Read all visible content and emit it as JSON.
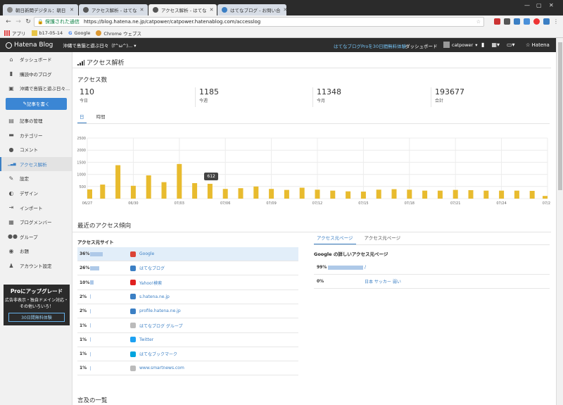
{
  "browser": {
    "tabs": [
      {
        "title": "朝日新聞デジタル：朝日",
        "color": "#888888"
      },
      {
        "title": "アクセス解析 - はてな",
        "color": "#555555"
      },
      {
        "title": "アクセス解析 - はてな",
        "color": "#555555"
      },
      {
        "title": "はてなブログ - お問い合",
        "color": "#3b7fc4"
      }
    ],
    "secure_label": "保護された通信",
    "url": "https://blog.hatena.ne.jp/catpower/catpower.hatenablog.com/accesslog",
    "bookmarks": [
      {
        "label": "アプリ",
        "icon": "apps-icon"
      },
      {
        "label": "b17-05-14",
        "icon": "folder-icon"
      },
      {
        "label": "Google",
        "icon": "google-icon"
      },
      {
        "label": "Chrome ウェブス",
        "icon": "chrome-icon"
      }
    ]
  },
  "header": {
    "logo": "Hatena Blog",
    "blog_name": "沖縄で島猫と遊ぶ日々（f^ω^)...",
    "pro_link": "はてなブログProを30日間無料体験",
    "dashboard": "ダッシュボード",
    "user": "catpower",
    "hatena": "Hatena"
  },
  "sidebar": {
    "items": [
      {
        "label": "ダッシュボード",
        "icon": "home-icon"
      },
      {
        "label": "購読中のブログ",
        "icon": "bookmark-icon"
      },
      {
        "label": "沖縄で島猫と遊ぶ日々...",
        "icon": "blog-icon"
      }
    ],
    "write_button": "記事を書く",
    "items2": [
      {
        "label": "記事の管理",
        "icon": "document-icon"
      },
      {
        "label": "カテゴリー",
        "icon": "folder-icon"
      },
      {
        "label": "コメント",
        "icon": "comment-icon"
      },
      {
        "label": "アクセス解析",
        "icon": "chart-icon",
        "active": true
      },
      {
        "label": "設定",
        "icon": "wrench-icon"
      },
      {
        "label": "デザイン",
        "icon": "palette-icon"
      },
      {
        "label": "インポート",
        "icon": "import-icon"
      },
      {
        "label": "ブログメンバー",
        "icon": "members-icon"
      },
      {
        "label": "グループ",
        "icon": "group-icon"
      },
      {
        "label": "お題",
        "icon": "topic-icon"
      },
      {
        "label": "アカウント設定",
        "icon": "account-icon"
      }
    ],
    "pro": {
      "title": "Proにアップグレード",
      "desc": "広告非表示・独自ドメイン対応・その他いろいろ！",
      "button": "30日間無料体験"
    }
  },
  "main": {
    "title": "アクセス解析",
    "access_title": "アクセス数",
    "stats": [
      {
        "value": "110",
        "label": "今日"
      },
      {
        "value": "1185",
        "label": "今週"
      },
      {
        "value": "11348",
        "label": "今月"
      },
      {
        "value": "193677",
        "label": "合計"
      }
    ],
    "tabs": [
      "日",
      "時間"
    ],
    "tooltip": "612",
    "trend_title": "最近のアクセス傾向",
    "sources_title": "アクセス元サイト",
    "sources": [
      {
        "pct": "36%",
        "frac": 0.36,
        "name": "Google",
        "icon": "google-icon",
        "color": "#db4437"
      },
      {
        "pct": "26%",
        "frac": 0.26,
        "name": "はてなブログ",
        "icon": "hatena-blog-icon",
        "color": "#3b7fc4"
      },
      {
        "pct": "10%",
        "frac": 0.1,
        "name": "Yahoo!検索",
        "icon": "yahoo-icon",
        "color": "#e02020"
      },
      {
        "pct": "2%",
        "frac": 0.02,
        "name": "s.hatena.ne.jp",
        "icon": "hatena-star-icon",
        "color": "#3b7fc4"
      },
      {
        "pct": "2%",
        "frac": 0.02,
        "name": "profile.hatena.ne.jp",
        "icon": "profile-icon",
        "color": "#3b7fc4"
      },
      {
        "pct": "1%",
        "frac": 0.01,
        "name": "はてなブログ グループ",
        "icon": "page-icon",
        "color": "#bbbbbb"
      },
      {
        "pct": "1%",
        "frac": 0.01,
        "name": "Twitter",
        "icon": "twitter-icon",
        "color": "#1da1f2"
      },
      {
        "pct": "1%",
        "frac": 0.01,
        "name": "はてなブックマーク",
        "icon": "hatena-bookmark-icon",
        "color": "#00a4de"
      },
      {
        "pct": "1%",
        "frac": 0.01,
        "name": "www.smartnews.com",
        "icon": "page-icon",
        "color": "#bbbbbb"
      }
    ],
    "right_tabs": [
      "アクセス元ページ",
      "アクセス元ページ"
    ],
    "right_title": "Google の詳しいアクセス元ページ",
    "right_rows": [
      {
        "pct": "99%",
        "frac": 0.99,
        "name": "/"
      },
      {
        "pct": "0%",
        "frac": 0.0,
        "name": "日本 サッカー 弱い"
      }
    ],
    "mentions_title": "言及の一覧"
  },
  "chart_data": {
    "type": "bar",
    "color": "#e8bb2e",
    "ylim": [
      0,
      2500
    ],
    "yticks": [
      "2500",
      "2000",
      "1500",
      "1000",
      "500"
    ],
    "xticks": [
      "06/27",
      "06/30",
      "07/03",
      "07/06",
      "07/09",
      "07/12",
      "07/15",
      "07/18",
      "07/21",
      "07/24",
      "07/27"
    ],
    "values": [
      380,
      580,
      1380,
      530,
      960,
      680,
      1430,
      640,
      612,
      400,
      430,
      500,
      400,
      360,
      450,
      370,
      330,
      300,
      290,
      370,
      390,
      370,
      330,
      330,
      360,
      350,
      330,
      330,
      330,
      320,
      110
    ],
    "tooltip_index": 8
  }
}
